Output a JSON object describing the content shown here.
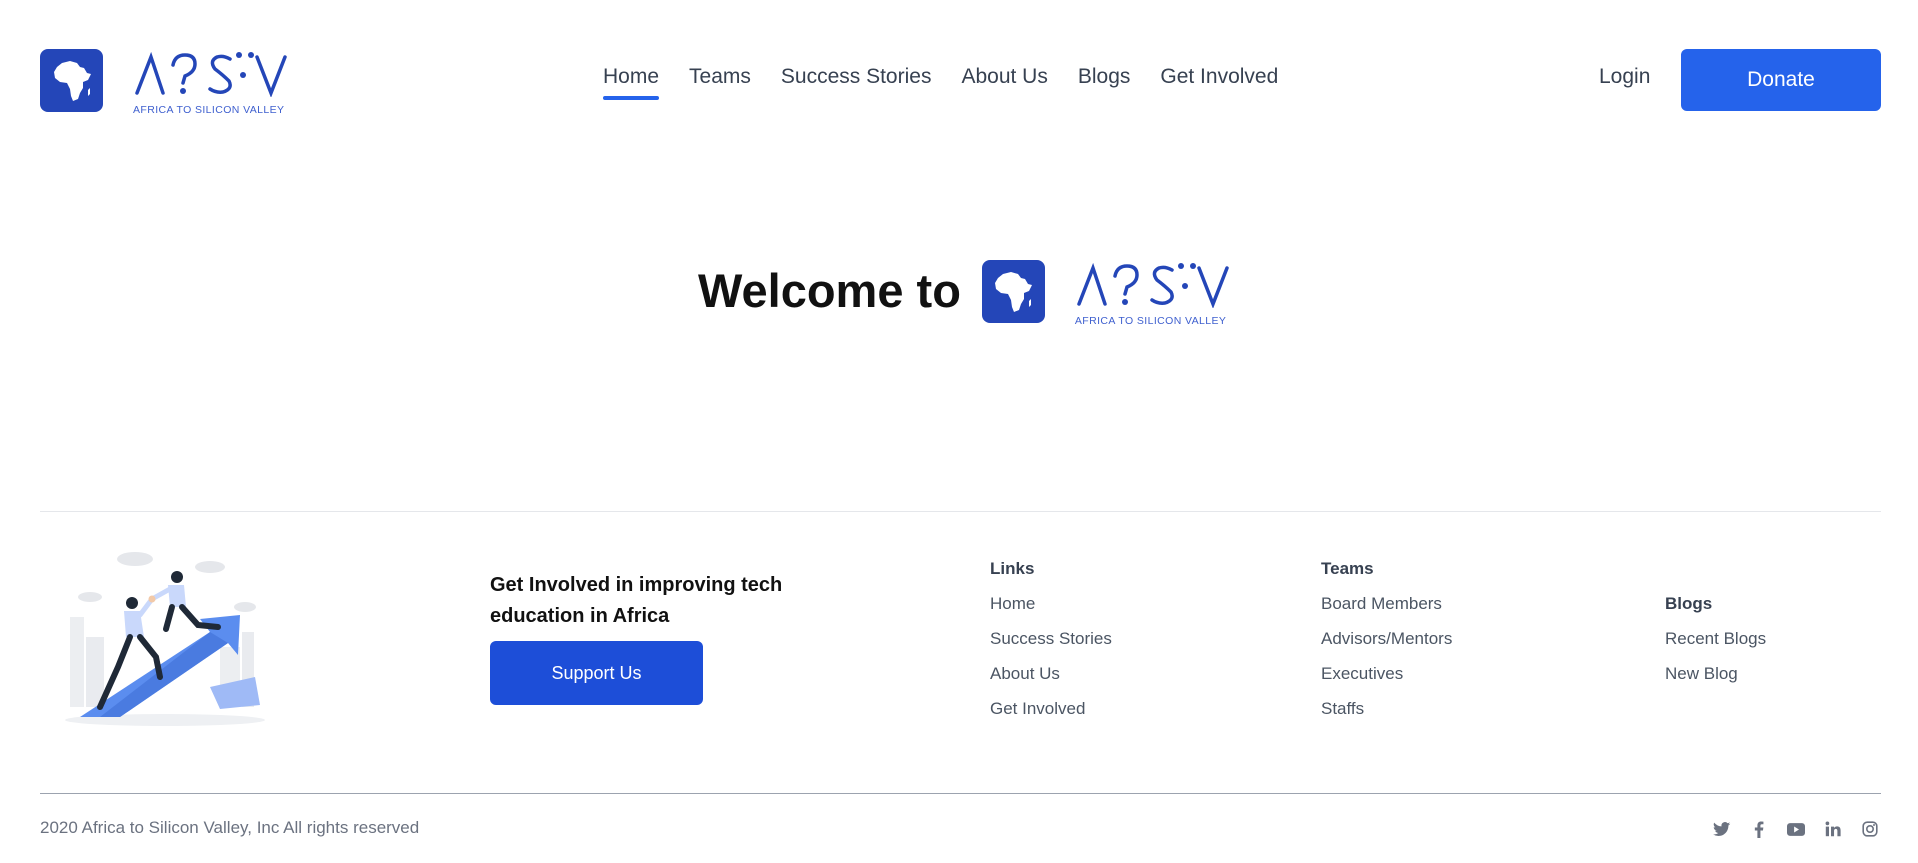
{
  "brand": {
    "logo_text": "A2SV",
    "logo_letters": "ʌ?S̈V",
    "tagline": "AFRICA TO SILICON VALLEY",
    "color": "#2446b8",
    "icon": "africa-map-icon"
  },
  "nav": {
    "items": [
      {
        "label": "Home",
        "active": true
      },
      {
        "label": "Teams"
      },
      {
        "label": "Success Stories"
      },
      {
        "label": "About Us"
      },
      {
        "label": "Blogs"
      },
      {
        "label": "Get Involved"
      }
    ],
    "accent": "#2563eb"
  },
  "header": {
    "login_label": "Login",
    "donate_label": "Donate",
    "donate_color": "#2563eb"
  },
  "hero": {
    "title": "Welcome to"
  },
  "footer": {
    "cta_text": "Get Involved in improving tech education in Africa",
    "support_label": "Support Us",
    "support_color": "#1d4ed8",
    "columns": {
      "links": {
        "title": "Links",
        "items": [
          "Home",
          "Success Stories",
          "About Us",
          "Get Involved"
        ]
      },
      "teams": {
        "title": "Teams",
        "items": [
          "Board Members",
          "Advisors/Mentors",
          "Executives",
          "Staffs"
        ]
      },
      "blogs": {
        "title": "Blogs",
        "items": [
          "Recent Blogs",
          "New Blog"
        ]
      }
    },
    "copyright": "2020 Africa to Silicon Valley, Inc All rights reserved",
    "socials": [
      "twitter-icon",
      "facebook-icon",
      "youtube-icon",
      "linkedin-icon",
      "instagram-icon"
    ]
  }
}
